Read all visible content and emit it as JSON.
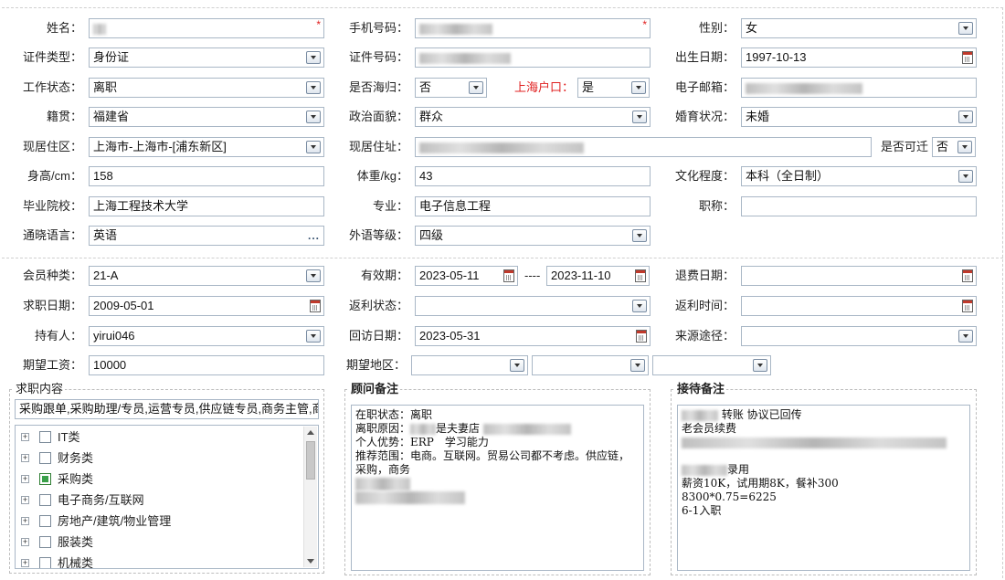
{
  "row1": {
    "name_label": "姓名：",
    "name_value": "",
    "required_mark": "*",
    "phone_label": "手机号码：",
    "phone_value": "",
    "gender_label": "性别：",
    "gender_value": "女"
  },
  "row2": {
    "id_type_label": "证件类型：",
    "id_type_value": "身份证",
    "id_number_label": "证件号码：",
    "id_number_value": "",
    "birth_label": "出生日期：",
    "birth_value": "1997-10-13"
  },
  "row3": {
    "work_status_label": "工作状态：",
    "work_status_value": "离职",
    "returnee_label": "是否海归：",
    "returnee_value": "否",
    "shanghai_hukou_label": "上海户口：",
    "shanghai_hukou_value": "是",
    "email_label": "电子邮箱：",
    "email_value": ""
  },
  "row4": {
    "native_label": "籍贯：",
    "native_value": "福建省",
    "political_label": "政治面貌：",
    "political_value": "群众",
    "marital_label": "婚育状况：",
    "marital_value": "未婚"
  },
  "row5": {
    "area_label": "现居住区：",
    "area_value": "上海市-上海市-[浦东新区]",
    "address_label": "现居住址：",
    "address_value": "",
    "relocate_label": "是否可迁",
    "relocate_value": "否"
  },
  "row6": {
    "height_label": "身高/cm：",
    "height_value": "158",
    "weight_label": "体重/kg：",
    "weight_value": "43",
    "education_label": "文化程度：",
    "education_value": "本科（全日制）"
  },
  "row7": {
    "school_label": "毕业院校：",
    "school_value": "上海工程技术大学",
    "major_label": "专业：",
    "major_value": "电子信息工程",
    "title_label": "职称：",
    "title_value": ""
  },
  "row8": {
    "language_label": "通晓语言：",
    "language_value": "英语",
    "more_icon": "...",
    "language_level_label": "外语等级：",
    "language_level_value": "四级"
  },
  "row9": {
    "member_type_label": "会员种类：",
    "member_type_value": "21-A",
    "validity_label": "有效期：",
    "validity_start": "2023-05-11",
    "validity_sep": "----",
    "validity_end": "2023-11-10",
    "refund_date_label": "退费日期：",
    "refund_date_value": ""
  },
  "row10": {
    "job_date_label": "求职日期：",
    "job_date_value": "2009-05-01",
    "rebate_status_label": "返利状态：",
    "rebate_status_value": "",
    "rebate_time_label": "返利时间：",
    "rebate_time_value": ""
  },
  "row11": {
    "holder_label": "持有人：",
    "holder_value": "yirui046",
    "revisit_label": "回访日期：",
    "revisit_value": "2023-05-31",
    "source_label": "来源途径：",
    "source_value": ""
  },
  "row12": {
    "salary_label": "期望工资：",
    "salary_value": "10000",
    "region_label": "期望地区：",
    "region_1": "",
    "region_2": "",
    "region_3": ""
  },
  "job_content": {
    "legend": "求职内容",
    "summary": "采购跟单,采购助理/专员,运营专员,供应链专员,商务主管,商",
    "tree": [
      {
        "label": "IT类",
        "checked": false
      },
      {
        "label": "财务类",
        "checked": false
      },
      {
        "label": "采购类",
        "checked": true
      },
      {
        "label": "电子商务/互联网",
        "checked": false
      },
      {
        "label": "房地产/建筑/物业管理",
        "checked": false
      },
      {
        "label": "服装类",
        "checked": false
      },
      {
        "label": "机械类",
        "checked": false
      }
    ],
    "expand_symbol": "+"
  },
  "advisor_notes": {
    "legend": "顾问备注",
    "line1": "在职状态：离职",
    "line2_prefix": "离职原因：",
    "line2_suffix": "是夫妻店",
    "line3": "个人优势：ERP　学习能力",
    "line4": "推荐范围：电商。互联网。贸易公司都不考虑。供应链，采购，商务"
  },
  "reception_notes": {
    "legend": "接待备注",
    "line1_suffix": "转账 协议已回传",
    "line2": "老会员续费",
    "line3_suffix": "录用",
    "line4": "薪资10K，试用期8K，餐补300",
    "line5": "8300*0.75=6225",
    "line6": "6-1入职"
  },
  "colors": {
    "label_red": "#e02020",
    "checked_green": "#3aa14a",
    "input_border": "#a9b7c6"
  }
}
